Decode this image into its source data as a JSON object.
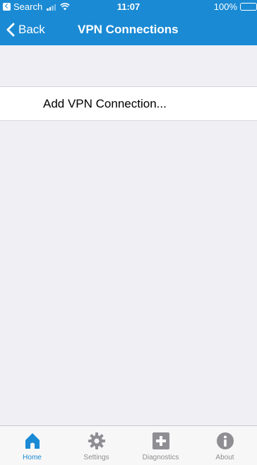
{
  "status_bar": {
    "back_app_label": "Search",
    "time": "11:07",
    "battery_percent": "100%",
    "battery_level": 1.0,
    "signal_bars": 2
  },
  "nav": {
    "back_label": "Back",
    "title": "VPN Connections"
  },
  "list": {
    "add_vpn_label": "Add VPN Connection..."
  },
  "tab_bar": {
    "active_tab": "Home",
    "tabs": [
      {
        "label": "Home",
        "icon": "home-icon"
      },
      {
        "label": "Settings",
        "icon": "gear-icon"
      },
      {
        "label": "Diagnostics",
        "icon": "plus-box-icon"
      },
      {
        "label": "About",
        "icon": "info-icon"
      }
    ]
  },
  "colors": {
    "accent": "#1a8ad4",
    "inactive": "#8e8e93",
    "background": "#efeff4"
  }
}
